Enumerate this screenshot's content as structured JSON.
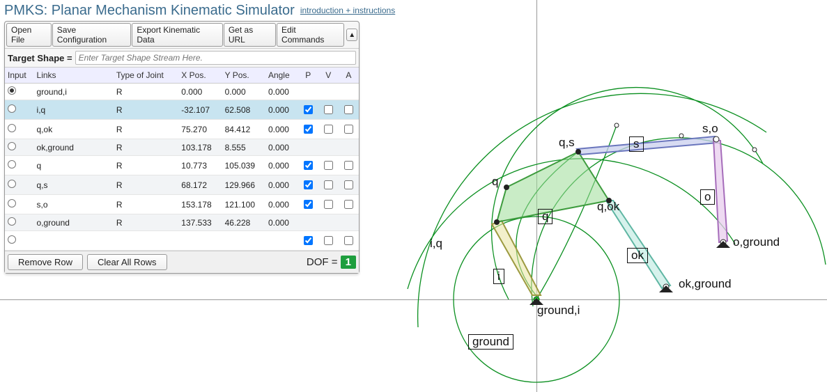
{
  "app_title": "PMKS: Planar Mechanism Kinematic Simulator",
  "help_link": "introduction + instructions",
  "toolbar": {
    "open": "Open File",
    "save": "Save Configuration",
    "export": "Export Kinematic Data",
    "geturl": "Get as URL",
    "edit": "Edit Commands"
  },
  "target_label": "Target Shape =",
  "target_placeholder": "Enter Target Shape Stream Here.",
  "columns": {
    "input": "Input",
    "links": "Links",
    "type": "Type of Joint",
    "x": "X Pos.",
    "y": "Y Pos.",
    "angle": "Angle",
    "p": "P",
    "v": "V",
    "a": "A"
  },
  "joints": [
    {
      "input": true,
      "links": "ground,i",
      "type": "R",
      "x": "0.000",
      "y": "0.000",
      "angle": "0.000",
      "p": null,
      "v": null,
      "a": null,
      "selected": false
    },
    {
      "input": false,
      "links": "i,q",
      "type": "R",
      "x": "-32.107",
      "y": "62.508",
      "angle": "0.000",
      "p": true,
      "v": false,
      "a": false,
      "selected": true
    },
    {
      "input": false,
      "links": "q,ok",
      "type": "R",
      "x": "75.270",
      "y": "84.412",
      "angle": "0.000",
      "p": true,
      "v": false,
      "a": false,
      "selected": false
    },
    {
      "input": false,
      "links": "ok,ground",
      "type": "R",
      "x": "103.178",
      "y": "8.555",
      "angle": "0.000",
      "p": null,
      "v": null,
      "a": null,
      "selected": false
    },
    {
      "input": false,
      "links": "q",
      "type": "R",
      "x": "10.773",
      "y": "105.039",
      "angle": "0.000",
      "p": true,
      "v": false,
      "a": false,
      "selected": false
    },
    {
      "input": false,
      "links": "q,s",
      "type": "R",
      "x": "68.172",
      "y": "129.966",
      "angle": "0.000",
      "p": true,
      "v": false,
      "a": false,
      "selected": false
    },
    {
      "input": false,
      "links": "s,o",
      "type": "R",
      "x": "153.178",
      "y": "121.100",
      "angle": "0.000",
      "p": true,
      "v": false,
      "a": false,
      "selected": false
    },
    {
      "input": false,
      "links": "o,ground",
      "type": "R",
      "x": "137.533",
      "y": "46.228",
      "angle": "0.000",
      "p": null,
      "v": null,
      "a": null,
      "selected": false
    },
    {
      "input": false,
      "links": "",
      "type": "",
      "x": "",
      "y": "",
      "angle": "",
      "p": true,
      "v": false,
      "a": false,
      "selected": false
    }
  ],
  "buttons": {
    "remove": "Remove Row",
    "clear": "Clear All Rows"
  },
  "dof_label": "DOF = ",
  "dof_value": "1",
  "scene_labels": {
    "iq": "i,q",
    "q": "q",
    "qs": "q,s",
    "so": "s,o",
    "qok": "q,ok",
    "okg": "ok,ground",
    "og": "o,ground",
    "gi": "ground,i",
    "link_i": "i",
    "link_q": "q",
    "link_s": "s",
    "link_o": "o",
    "link_ok": "ok",
    "link_ground": "ground"
  }
}
